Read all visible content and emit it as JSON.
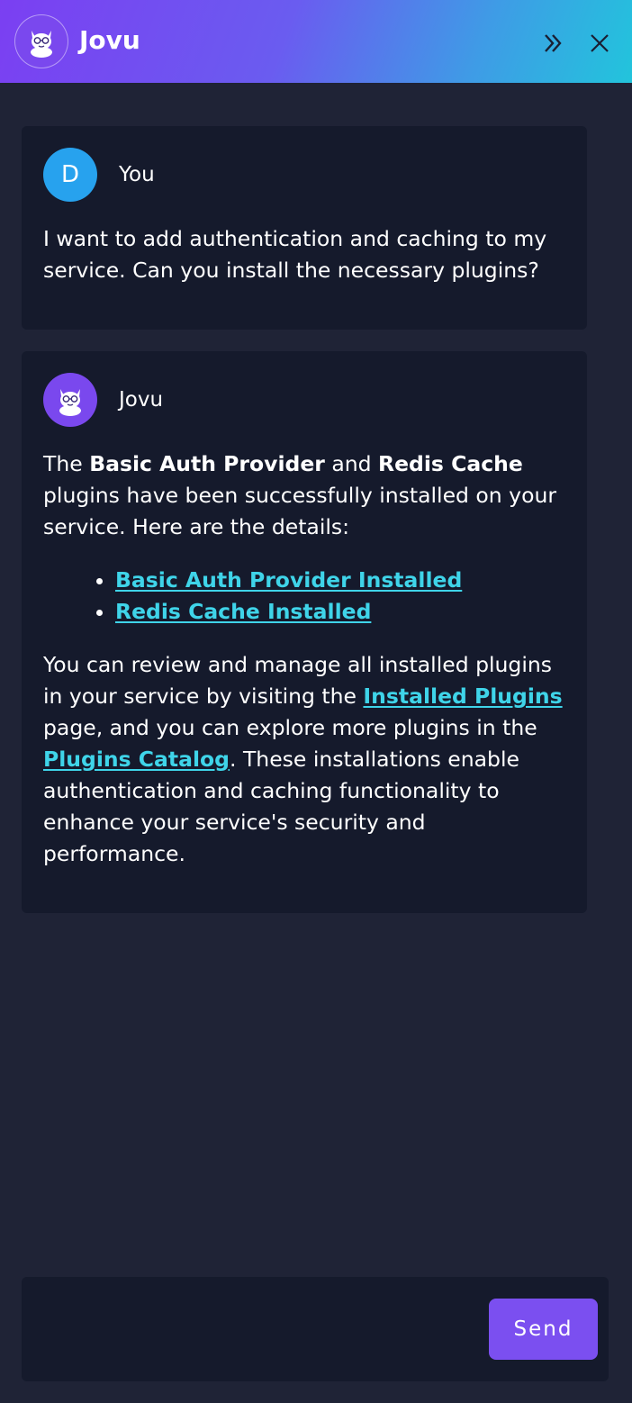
{
  "header": {
    "title": "Jovu",
    "logo_icon": "squirrel-glasses-icon",
    "collapse_icon": "double-chevron-right-icon",
    "close_icon": "close-icon"
  },
  "messages": [
    {
      "sender": "You",
      "avatar_initial": "D",
      "avatar_color": "#27a2ee",
      "text": "I want to add authentication and caching to my service. Can you install the necessary plugins?"
    },
    {
      "sender": "Jovu",
      "avatar_icon": "squirrel-glasses-icon",
      "avatar_color": "#7a48ee",
      "intro": {
        "prefix": "The ",
        "bold_1": "Basic Auth Provider",
        "middle": " and ",
        "bold_2": "Redis Cache",
        "suffix": " plugins have been successfully installed on your service. Here are the details:"
      },
      "links": [
        "Basic Auth Provider Installed",
        "Redis Cache Installed"
      ],
      "outro": {
        "part_1": "You can review and manage all installed plugins in your service by visiting the ",
        "link_1": "Installed Plugins",
        "part_2": " page, and you can explore more plugins in the ",
        "link_2": "Plugins Catalog",
        "part_3": ". These installations enable authentication and caching functionality to enhance your service's security and performance."
      }
    }
  ],
  "composer": {
    "input_value": "",
    "send_label": "Send"
  },
  "colors": {
    "background": "#1f2336",
    "card": "#151a2c",
    "link": "#3fd4e9",
    "accent": "#7b4ff0"
  }
}
